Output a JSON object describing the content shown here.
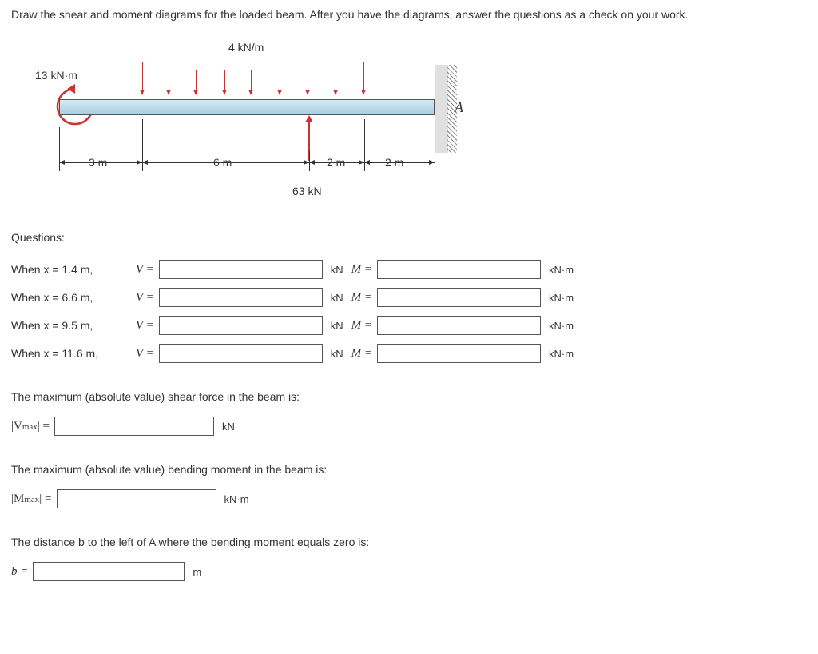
{
  "instructions": "Draw the shear and moment diagrams for the loaded beam. After you have the diagrams, answer the questions as a check on your work.",
  "figure": {
    "dist_load_label": "4 kN/m",
    "moment_label": "13 kN·m",
    "dim_3m": "3 m",
    "dim_6m": "6 m",
    "dim_2m_a": "2 m",
    "dim_2m_b": "2 m",
    "point_load_label": "63 kN",
    "label_A": "A"
  },
  "questions_heading": "Questions:",
  "rows": [
    {
      "prompt": "When x = 1.4 m,",
      "v_label": "V =",
      "v_unit": "kN",
      "m_label": "M =",
      "m_unit": "kN·m"
    },
    {
      "prompt": "When x = 6.6 m,",
      "v_label": "V =",
      "v_unit": "kN",
      "m_label": "M =",
      "m_unit": "kN·m"
    },
    {
      "prompt": "When x = 9.5 m,",
      "v_label": "V =",
      "v_unit": "kN",
      "m_label": "M =",
      "m_unit": "kN·m"
    },
    {
      "prompt": "When x = 11.6 m,",
      "v_label": "V =",
      "v_unit": "kN",
      "m_label": "M =",
      "m_unit": "kN·m"
    }
  ],
  "max_shear_text": "The maximum (absolute value) shear force in the beam is:",
  "vmax_label_prefix": "|V",
  "vmax_label_sub": "max",
  "vmax_label_suffix": "| =",
  "vmax_unit": "kN",
  "max_moment_text": "The maximum (absolute value) bending moment in the beam is:",
  "mmax_label_prefix": "|M",
  "mmax_label_sub": "max",
  "mmax_label_suffix": "| =",
  "mmax_unit": "kN·m",
  "dist_b_text": "The distance b to the left of A where the bending moment equals zero is:",
  "b_label": "b =",
  "b_unit": "m"
}
